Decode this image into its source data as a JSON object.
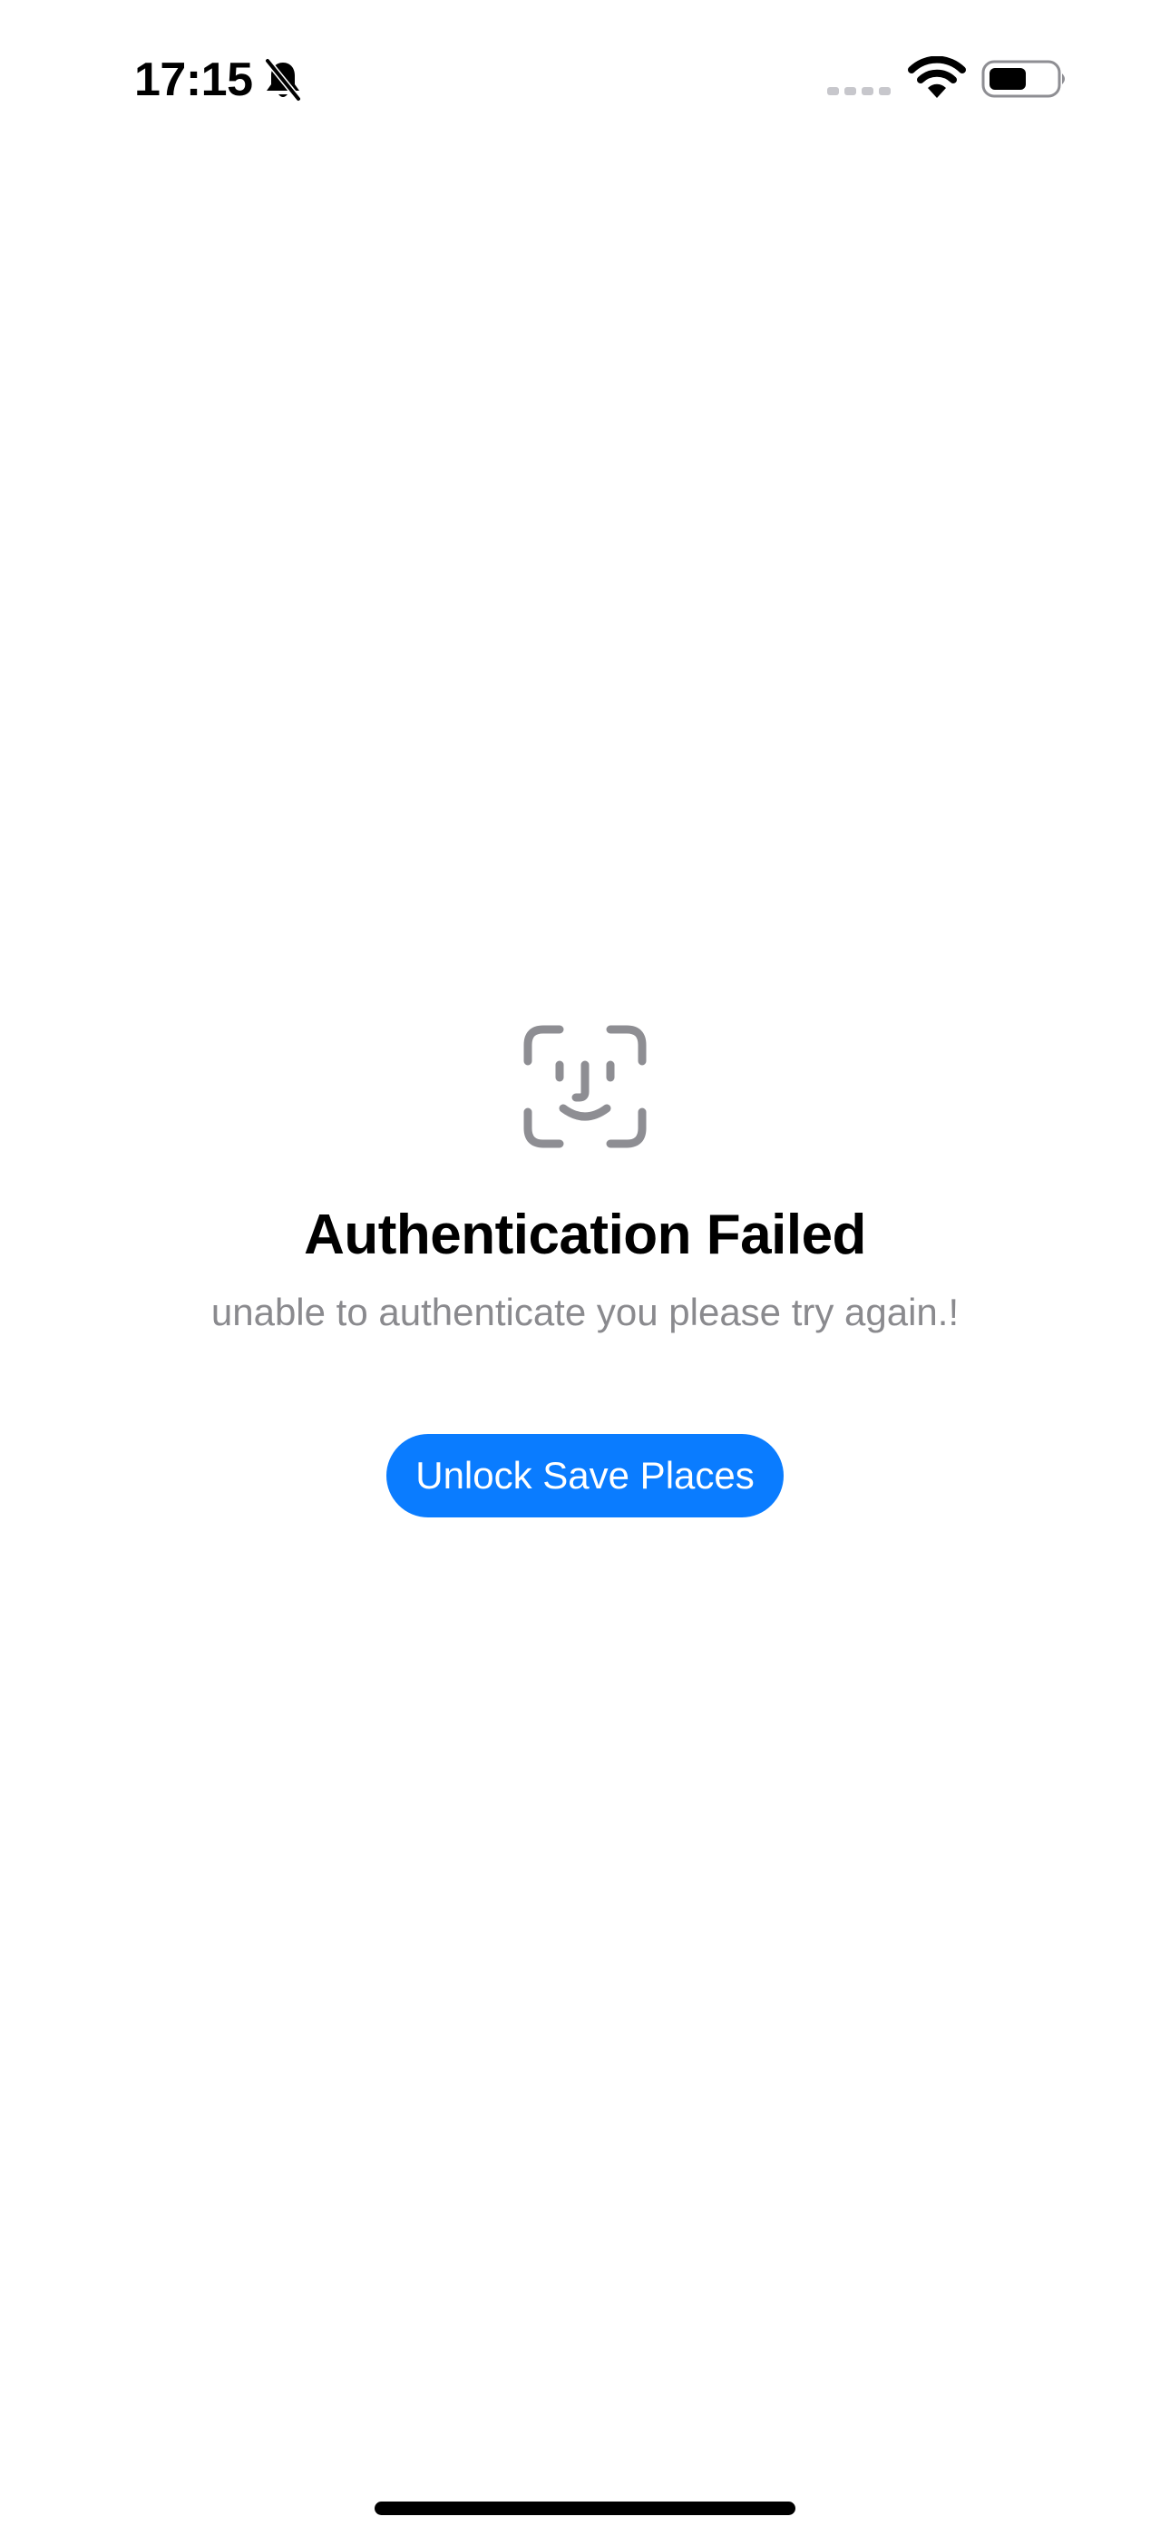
{
  "status_bar": {
    "time": "17:15",
    "icons": {
      "silent": "bell-slash-icon",
      "signal": "signal-icon",
      "wifi": "wifi-icon",
      "battery": "battery-icon"
    }
  },
  "auth": {
    "icon": "faceid-icon",
    "title": "Authentication Failed",
    "message": "unable to authenticate you please try again.!",
    "button_label": "Unlock Save Places"
  },
  "colors": {
    "accent": "#0a7cff",
    "secondary_text": "#8a8a8e",
    "icon_gray": "#8e8e93",
    "background": "#ffffff"
  }
}
